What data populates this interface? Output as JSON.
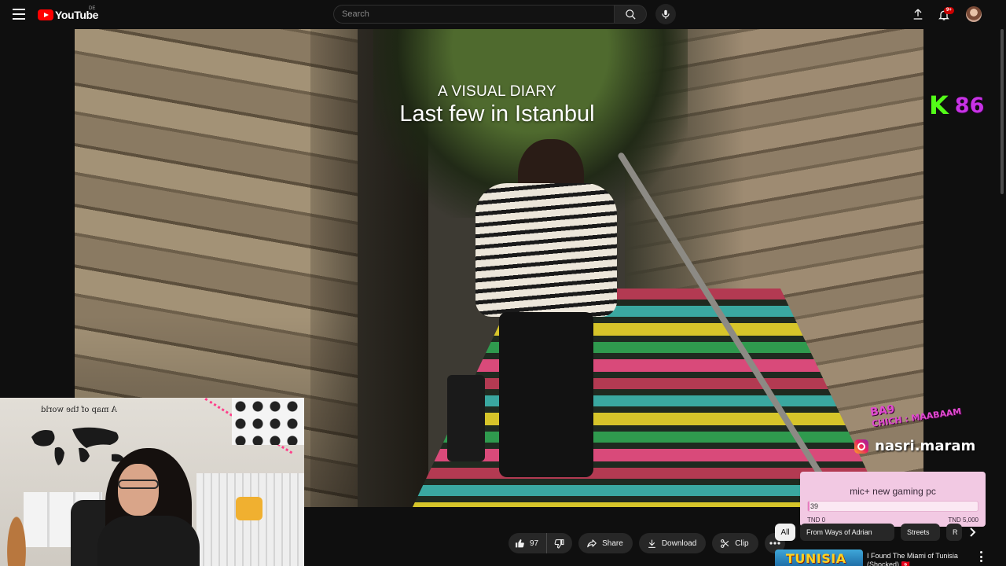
{
  "header": {
    "logo_text": "YouTube",
    "country_code": "DE",
    "search_placeholder": "Search",
    "notification_count": "9+"
  },
  "video": {
    "overlay_line1": "A VISUAL DIARY",
    "overlay_line2": "Last few in Istanbul"
  },
  "stream_overlay": {
    "kick_letter": "K",
    "kick_count": "86",
    "sticker_line1": "BA9",
    "sticker_line2": "CHICH : MAABAAM",
    "instagram_handle": "nasri.maram",
    "goal": {
      "title": "mic+ new gaming pc",
      "current": "39",
      "progress_fraction": 0.008,
      "min_label": "TND 0",
      "max_label": "TND 5,000"
    },
    "webcam_map_title": "A map of the world"
  },
  "actions": {
    "like_count": "97",
    "share_label": "Share",
    "download_label": "Download",
    "clip_label": "Clip"
  },
  "chips": {
    "all": "All",
    "items": [
      "From Ways of Adrian",
      "Streets",
      "R"
    ]
  },
  "recommendation": {
    "thumbnail_text": "TUNISIA",
    "title": "I Found The Miami of Tunisia (Shocked) 🇹🇳"
  },
  "colors": {
    "brand": "#ff0000",
    "kick_green": "#53fc18",
    "overlay_pink": "#c832e6",
    "goal_bg": "#f2c9e3"
  }
}
